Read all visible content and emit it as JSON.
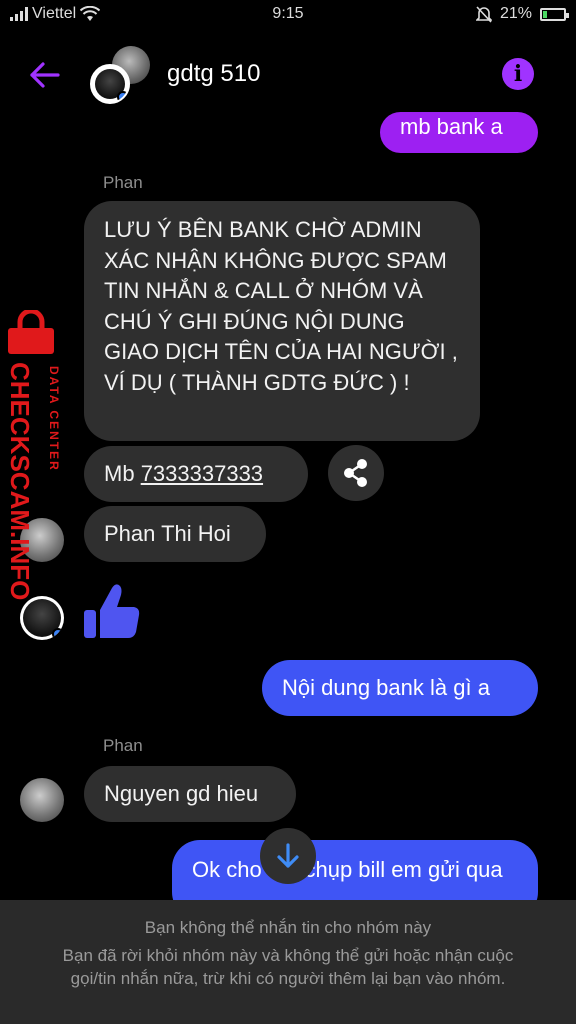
{
  "status_bar": {
    "carrier": "Viettel",
    "time": "9:15",
    "battery": "21%",
    "battery_level": 0.21
  },
  "header": {
    "title": "gdtg 510",
    "back_icon": "back-arrow-icon",
    "info_icon": "info-icon"
  },
  "messages": {
    "m1": "mb bank a",
    "sender1": "Phan",
    "m2": "LƯU Ý BÊN BANK CHỜ ADMIN XÁC NHẬN KHÔNG ĐƯỢC SPAM TIN NHẮN & CALL Ở NHÓM VÀ CHÚ Ý GHI ĐÚNG NỘI DUNG GIAO DỊCH TÊN CỦA HAI NGƯỜI , VÍ DỤ ( THÀNH GDTG ĐỨC ) !",
    "m3_prefix": "Mb ",
    "m3_number": "7333337333",
    "m4": "Phan Thi Hoi",
    "m5": "Nội dung bank là gì a",
    "sender2": "Phan",
    "m6": "Nguyen gd hieu",
    "m7": "Ok cho em chụp bill em gửi qua"
  },
  "watermark": {
    "line1": "DATA CENTER",
    "line2": "CHECKSCAM.INFO"
  },
  "footer": {
    "line1": "Bạn không thể nhắn tin cho nhóm này",
    "line2": "Bạn đã rời khỏi nhóm này và không thể gửi hoặc nhận cuộc gọi/tin nhắn nữa, trừ khi có người thêm lại bạn vào nhóm."
  },
  "colors": {
    "accent": "#9d20f2",
    "outgoing_blue": "#3f55f5",
    "incoming": "#2f2f2f",
    "watermark_red": "#e0191b"
  }
}
